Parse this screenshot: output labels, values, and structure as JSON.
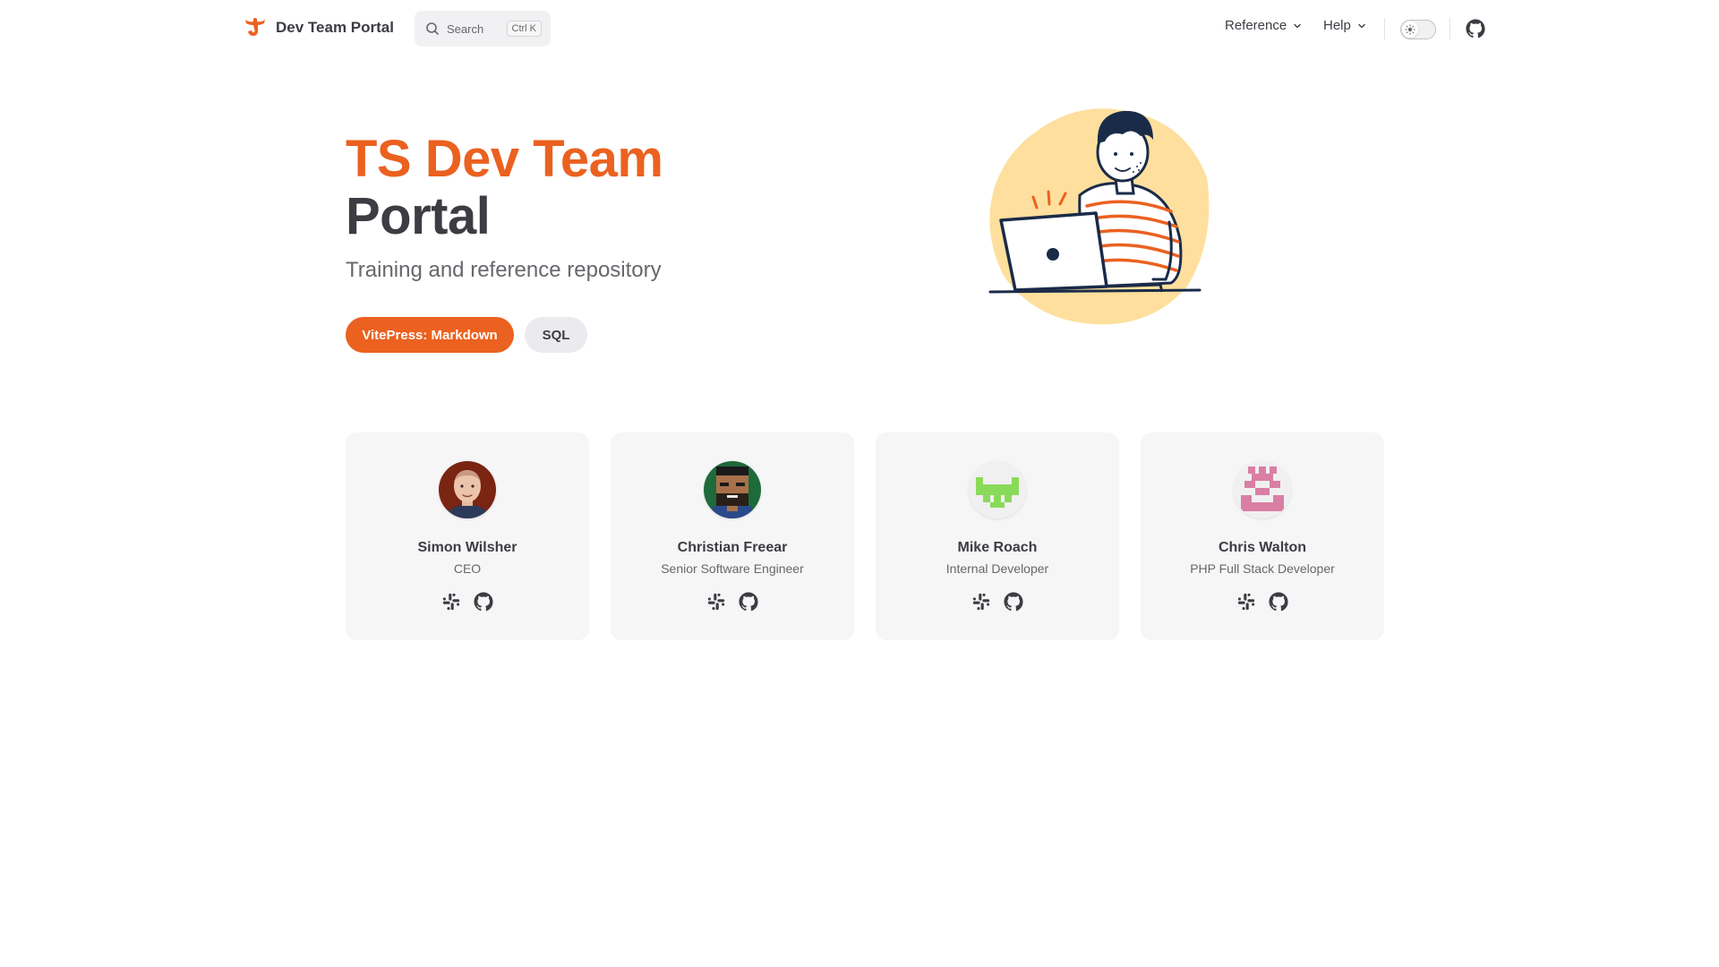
{
  "nav": {
    "title": "Dev Team Portal",
    "search_label": "Search",
    "search_shortcut": "Ctrl K",
    "menus": [
      {
        "label": "Reference"
      },
      {
        "label": "Help"
      }
    ],
    "appearance_toggle": "sun-icon",
    "social_icon": "github-icon"
  },
  "hero": {
    "name": "TS Dev Team",
    "text": "Portal",
    "tagline": "Training and reference repository",
    "actions": [
      {
        "label": "VitePress: Markdown",
        "theme": "brand"
      },
      {
        "label": "SQL",
        "theme": "alt"
      }
    ]
  },
  "team": [
    {
      "name": "Simon Wilsher",
      "title": "CEO",
      "links": [
        "slack-icon",
        "github-icon"
      ]
    },
    {
      "name": "Christian Freear",
      "title": "Senior Software Engineer",
      "links": [
        "slack-icon",
        "github-icon"
      ]
    },
    {
      "name": "Mike Roach",
      "title": "Internal Developer",
      "links": [
        "slack-icon",
        "github-icon"
      ]
    },
    {
      "name": "Chris Walton",
      "title": "PHP Full Stack Developer",
      "links": [
        "slack-icon",
        "github-icon"
      ]
    }
  ],
  "colors": {
    "brand": "#eb6120",
    "text": "#3c3c43",
    "muted": "#67676c",
    "card_bg": "#f6f6f7",
    "hero_blob": "#fedf9d"
  }
}
